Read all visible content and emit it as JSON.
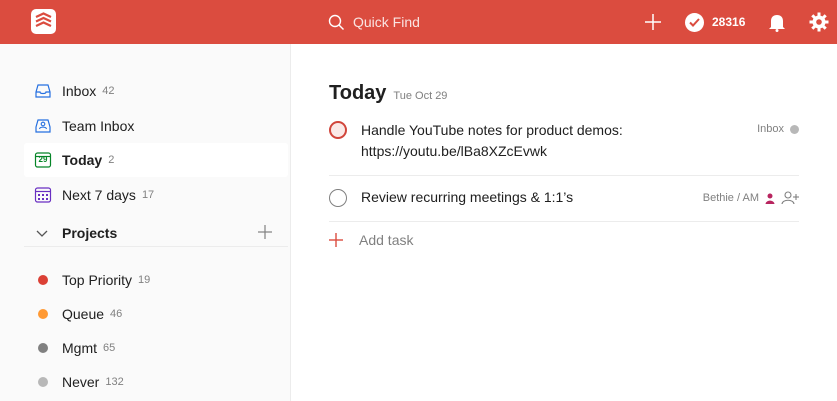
{
  "search": {
    "placeholder": "Quick Find"
  },
  "karma": {
    "value": "28316"
  },
  "colors": {
    "brand": "#db4c3f",
    "top_priority": "#db4035",
    "queue": "#ff9933",
    "mgmt": "#808080",
    "never": "#b8b8b8"
  },
  "sidebar": {
    "items": [
      {
        "label": "Inbox",
        "count": "42",
        "icon": "inbox-icon"
      },
      {
        "label": "Team Inbox",
        "count": "",
        "icon": "team-inbox-icon"
      },
      {
        "label": "Today",
        "count": "2",
        "icon": "calendar-today-icon",
        "day": "29"
      },
      {
        "label": "Next 7 days",
        "count": "17",
        "icon": "calendar-week-icon"
      }
    ],
    "projects_label": "Projects",
    "projects": [
      {
        "label": "Top Priority",
        "count": "19"
      },
      {
        "label": "Queue",
        "count": "46"
      },
      {
        "label": "Mgmt",
        "count": "65"
      },
      {
        "label": "Never",
        "count": "132"
      }
    ]
  },
  "main": {
    "title": "Today",
    "date": "Tue Oct 29",
    "tasks": [
      {
        "line1": "Handle YouTube notes for product demos:",
        "line2": "https://youtu.be/lBa8XZcEvwk",
        "project": "Inbox"
      },
      {
        "line1": "Review recurring meetings & 1:1’s",
        "project": "Bethie / AM"
      }
    ],
    "add_task_label": "Add task"
  }
}
